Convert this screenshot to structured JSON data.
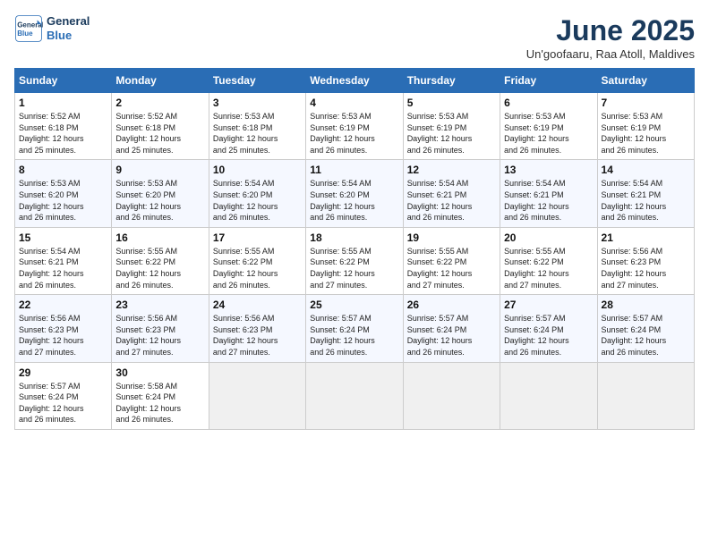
{
  "header": {
    "logo_line1": "General",
    "logo_line2": "Blue",
    "title": "June 2025",
    "subtitle": "Un'goofaaru, Raa Atoll, Maldives"
  },
  "weekdays": [
    "Sunday",
    "Monday",
    "Tuesday",
    "Wednesday",
    "Thursday",
    "Friday",
    "Saturday"
  ],
  "weeks": [
    [
      {
        "day": "1",
        "info": "Sunrise: 5:52 AM\nSunset: 6:18 PM\nDaylight: 12 hours\nand 25 minutes."
      },
      {
        "day": "2",
        "info": "Sunrise: 5:52 AM\nSunset: 6:18 PM\nDaylight: 12 hours\nand 25 minutes."
      },
      {
        "day": "3",
        "info": "Sunrise: 5:53 AM\nSunset: 6:18 PM\nDaylight: 12 hours\nand 25 minutes."
      },
      {
        "day": "4",
        "info": "Sunrise: 5:53 AM\nSunset: 6:19 PM\nDaylight: 12 hours\nand 26 minutes."
      },
      {
        "day": "5",
        "info": "Sunrise: 5:53 AM\nSunset: 6:19 PM\nDaylight: 12 hours\nand 26 minutes."
      },
      {
        "day": "6",
        "info": "Sunrise: 5:53 AM\nSunset: 6:19 PM\nDaylight: 12 hours\nand 26 minutes."
      },
      {
        "day": "7",
        "info": "Sunrise: 5:53 AM\nSunset: 6:19 PM\nDaylight: 12 hours\nand 26 minutes."
      }
    ],
    [
      {
        "day": "8",
        "info": "Sunrise: 5:53 AM\nSunset: 6:20 PM\nDaylight: 12 hours\nand 26 minutes."
      },
      {
        "day": "9",
        "info": "Sunrise: 5:53 AM\nSunset: 6:20 PM\nDaylight: 12 hours\nand 26 minutes."
      },
      {
        "day": "10",
        "info": "Sunrise: 5:54 AM\nSunset: 6:20 PM\nDaylight: 12 hours\nand 26 minutes."
      },
      {
        "day": "11",
        "info": "Sunrise: 5:54 AM\nSunset: 6:20 PM\nDaylight: 12 hours\nand 26 minutes."
      },
      {
        "day": "12",
        "info": "Sunrise: 5:54 AM\nSunset: 6:21 PM\nDaylight: 12 hours\nand 26 minutes."
      },
      {
        "day": "13",
        "info": "Sunrise: 5:54 AM\nSunset: 6:21 PM\nDaylight: 12 hours\nand 26 minutes."
      },
      {
        "day": "14",
        "info": "Sunrise: 5:54 AM\nSunset: 6:21 PM\nDaylight: 12 hours\nand 26 minutes."
      }
    ],
    [
      {
        "day": "15",
        "info": "Sunrise: 5:54 AM\nSunset: 6:21 PM\nDaylight: 12 hours\nand 26 minutes."
      },
      {
        "day": "16",
        "info": "Sunrise: 5:55 AM\nSunset: 6:22 PM\nDaylight: 12 hours\nand 26 minutes."
      },
      {
        "day": "17",
        "info": "Sunrise: 5:55 AM\nSunset: 6:22 PM\nDaylight: 12 hours\nand 26 minutes."
      },
      {
        "day": "18",
        "info": "Sunrise: 5:55 AM\nSunset: 6:22 PM\nDaylight: 12 hours\nand 27 minutes."
      },
      {
        "day": "19",
        "info": "Sunrise: 5:55 AM\nSunset: 6:22 PM\nDaylight: 12 hours\nand 27 minutes."
      },
      {
        "day": "20",
        "info": "Sunrise: 5:55 AM\nSunset: 6:22 PM\nDaylight: 12 hours\nand 27 minutes."
      },
      {
        "day": "21",
        "info": "Sunrise: 5:56 AM\nSunset: 6:23 PM\nDaylight: 12 hours\nand 27 minutes."
      }
    ],
    [
      {
        "day": "22",
        "info": "Sunrise: 5:56 AM\nSunset: 6:23 PM\nDaylight: 12 hours\nand 27 minutes."
      },
      {
        "day": "23",
        "info": "Sunrise: 5:56 AM\nSunset: 6:23 PM\nDaylight: 12 hours\nand 27 minutes."
      },
      {
        "day": "24",
        "info": "Sunrise: 5:56 AM\nSunset: 6:23 PM\nDaylight: 12 hours\nand 27 minutes."
      },
      {
        "day": "25",
        "info": "Sunrise: 5:57 AM\nSunset: 6:24 PM\nDaylight: 12 hours\nand 26 minutes."
      },
      {
        "day": "26",
        "info": "Sunrise: 5:57 AM\nSunset: 6:24 PM\nDaylight: 12 hours\nand 26 minutes."
      },
      {
        "day": "27",
        "info": "Sunrise: 5:57 AM\nSunset: 6:24 PM\nDaylight: 12 hours\nand 26 minutes."
      },
      {
        "day": "28",
        "info": "Sunrise: 5:57 AM\nSunset: 6:24 PM\nDaylight: 12 hours\nand 26 minutes."
      }
    ],
    [
      {
        "day": "29",
        "info": "Sunrise: 5:57 AM\nSunset: 6:24 PM\nDaylight: 12 hours\nand 26 minutes."
      },
      {
        "day": "30",
        "info": "Sunrise: 5:58 AM\nSunset: 6:24 PM\nDaylight: 12 hours\nand 26 minutes."
      },
      {
        "day": "",
        "info": ""
      },
      {
        "day": "",
        "info": ""
      },
      {
        "day": "",
        "info": ""
      },
      {
        "day": "",
        "info": ""
      },
      {
        "day": "",
        "info": ""
      }
    ]
  ]
}
